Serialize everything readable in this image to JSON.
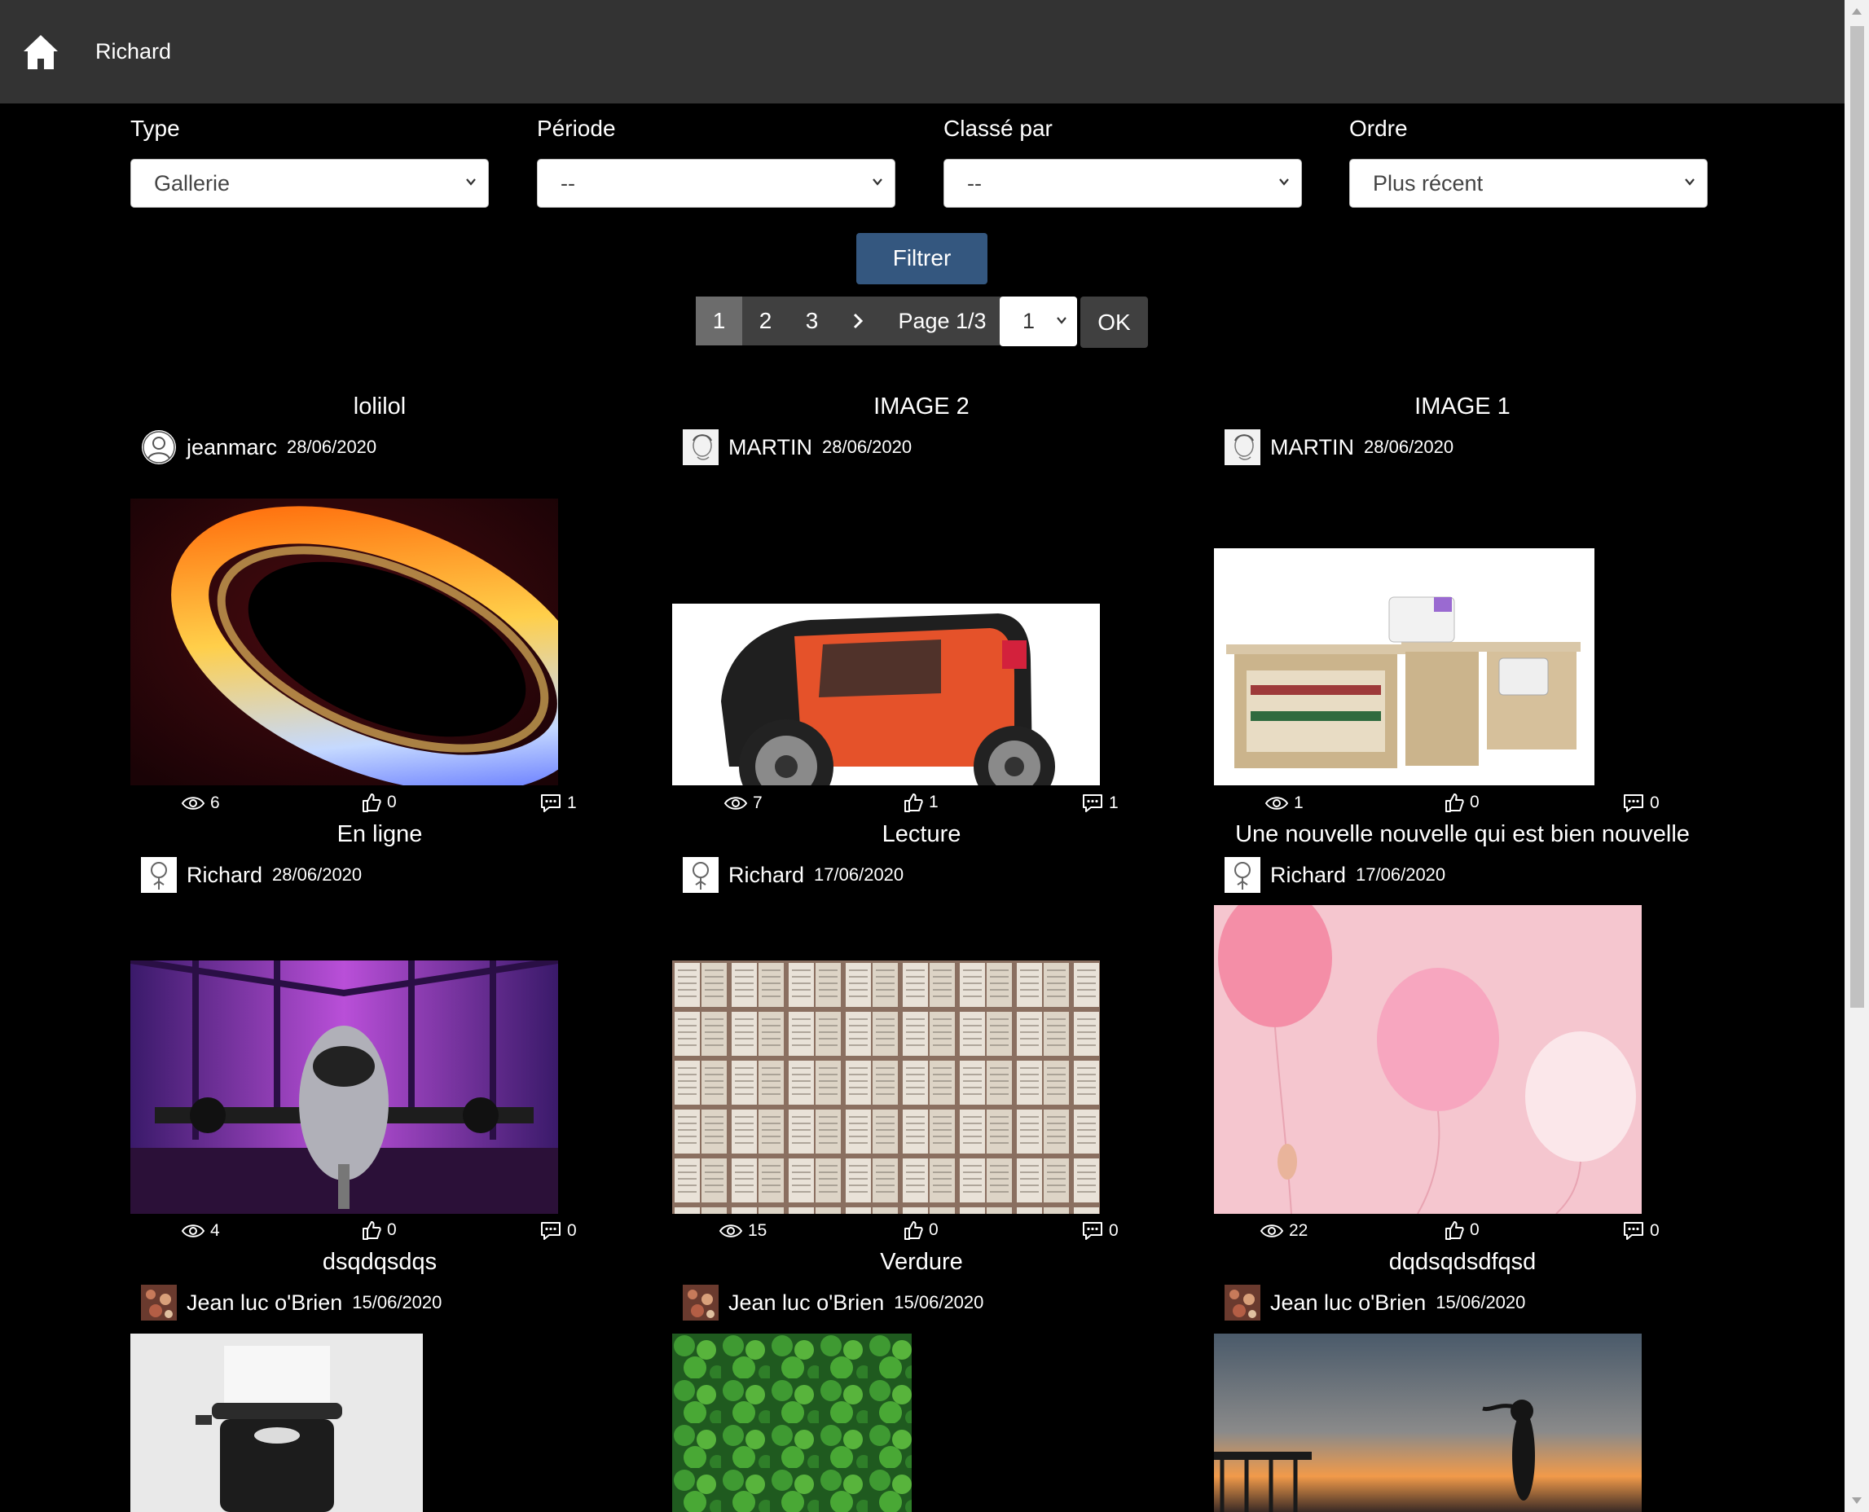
{
  "header": {
    "brand": "Richard"
  },
  "filters": {
    "type": {
      "label": "Type",
      "value": "Gallerie"
    },
    "period": {
      "label": "Période",
      "value": "--"
    },
    "sort": {
      "label": "Classé par",
      "value": "--"
    },
    "order": {
      "label": "Ordre",
      "value": "Plus récent"
    },
    "submit_label": "Filtrer"
  },
  "pagination": {
    "pages": [
      "1",
      "2",
      "3"
    ],
    "active": "1",
    "info": "Page 1/3",
    "select_value": "1",
    "ok_label": "OK"
  },
  "posts": [
    {
      "title": "lolilol",
      "author": "jeanmarc",
      "date": "28/06/2020",
      "views": "6",
      "likes": "0",
      "comments": "1"
    },
    {
      "title": "IMAGE 2",
      "author": "MARTIN",
      "date": "28/06/2020",
      "views": "7",
      "likes": "1",
      "comments": "1"
    },
    {
      "title": "IMAGE 1",
      "author": "MARTIN",
      "date": "28/06/2020",
      "views": "1",
      "likes": "0",
      "comments": "0"
    },
    {
      "title": "En ligne",
      "author": "Richard",
      "date": "28/06/2020",
      "views": "4",
      "likes": "0",
      "comments": "0"
    },
    {
      "title": "Lecture",
      "author": "Richard",
      "date": "17/06/2020",
      "views": "15",
      "likes": "0",
      "comments": "0"
    },
    {
      "title": "Une nouvelle nouvelle qui est bien nouvelle",
      "author": "Richard",
      "date": "17/06/2020",
      "views": "22",
      "likes": "0",
      "comments": "0"
    },
    {
      "title": "dsqdqsdqs",
      "author": "Jean luc o'Brien",
      "date": "15/06/2020"
    },
    {
      "title": "Verdure",
      "author": "Jean luc o'Brien",
      "date": "15/06/2020"
    },
    {
      "title": "dqdsqdsdfqsd",
      "author": "Jean luc o'Brien",
      "date": "15/06/2020"
    }
  ],
  "colors": {
    "topbar": "#333333",
    "filter_button": "#34577f",
    "pager": "#404040",
    "pager_active": "#6c6c6c"
  }
}
